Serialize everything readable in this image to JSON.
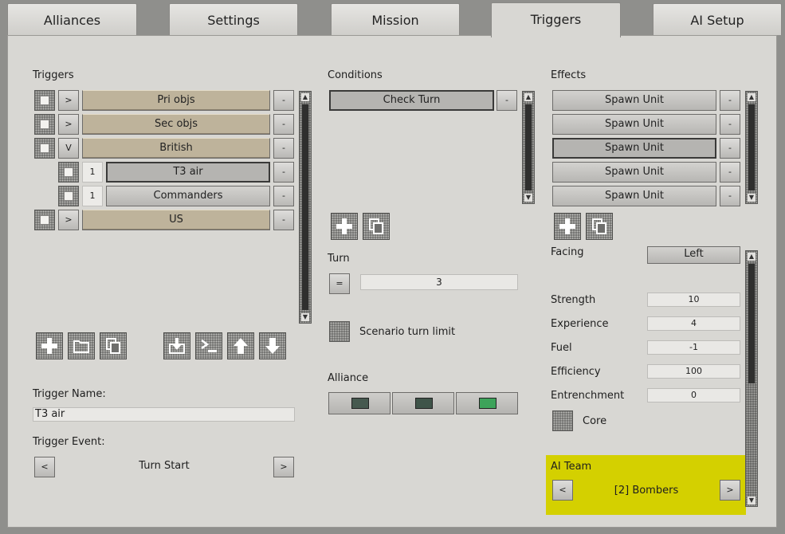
{
  "tabs": [
    {
      "label": "Alliances",
      "active": false
    },
    {
      "label": "Settings",
      "active": false
    },
    {
      "label": "Mission",
      "active": false
    },
    {
      "label": "Triggers",
      "active": true
    },
    {
      "label": "AI Setup",
      "active": false
    }
  ],
  "triggers": {
    "header": "Triggers",
    "items": [
      {
        "label": "Pri objs",
        "expander": ">",
        "remove": "-"
      },
      {
        "label": "Sec objs",
        "expander": ">",
        "remove": "-"
      },
      {
        "label": "British",
        "expander": "V",
        "remove": "-"
      },
      {
        "label": "T3 air",
        "number": "1",
        "remove": "-"
      },
      {
        "label": "Commanders",
        "number": "1",
        "remove": "-"
      },
      {
        "label": "US",
        "expander": ">",
        "remove": "-"
      }
    ],
    "toolbar": [
      "add-icon",
      "folder-icon",
      "copy-icon",
      "import-icon",
      "script-icon",
      "move-up-icon",
      "move-down-icon"
    ],
    "name_label": "Trigger Name:",
    "name_value": "T3 air",
    "event_label": "Trigger Event:",
    "event_value": "Turn Start",
    "prev": "<",
    "next": ">"
  },
  "conditions": {
    "header": "Conditions",
    "items": [
      {
        "label": "Check Turn",
        "remove": "-"
      }
    ],
    "turn_label": "Turn",
    "turn_operator": "=",
    "turn_value": "3",
    "scenario_limit_label": "Scenario turn limit",
    "alliance_label": "Alliance",
    "alliance_colors": [
      "#46594f",
      "#3f5449",
      "#3da35a"
    ]
  },
  "effects": {
    "header": "Effects",
    "items": [
      {
        "label": "Spawn Unit",
        "remove": "-"
      },
      {
        "label": "Spawn Unit",
        "remove": "-"
      },
      {
        "label": "Spawn Unit",
        "remove": "-"
      },
      {
        "label": "Spawn Unit",
        "remove": "-"
      },
      {
        "label": "Spawn Unit",
        "remove": "-"
      }
    ],
    "facing_label": "Facing",
    "facing_value": "Left",
    "strength_label": "Strength",
    "strength_value": "10",
    "experience_label": "Experience",
    "experience_value": "4",
    "fuel_label": "Fuel",
    "fuel_value": "-1",
    "efficiency_label": "Efficiency",
    "efficiency_value": "100",
    "entrenchment_label": "Entrenchment",
    "entrenchment_value": "0",
    "core_label": "Core",
    "ai_team_label": "AI Team",
    "ai_team_value": "[2] Bombers",
    "prev": "<",
    "next": ">",
    "highlight_color": "#d4d000"
  }
}
